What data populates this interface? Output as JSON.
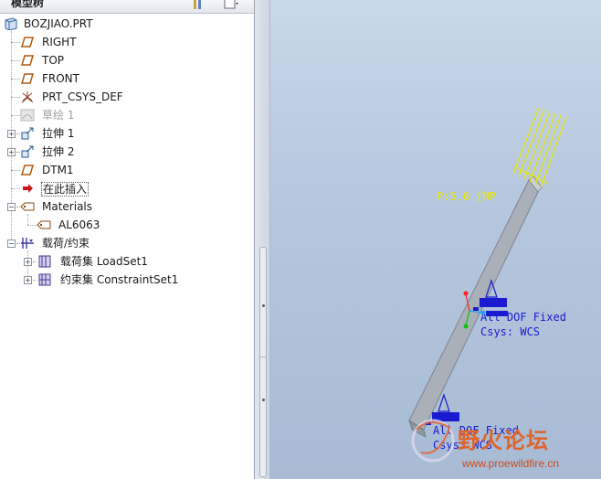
{
  "tree": {
    "header_title": "模型树",
    "items": [
      {
        "label": "BOZJIAO.PRT",
        "icon": "part-icon"
      },
      {
        "label": "RIGHT",
        "icon": "datum-plane-icon"
      },
      {
        "label": "TOP",
        "icon": "datum-plane-icon"
      },
      {
        "label": "FRONT",
        "icon": "datum-plane-icon"
      },
      {
        "label": "PRT_CSYS_DEF",
        "icon": "csys-icon"
      },
      {
        "label": "草绘 1",
        "icon": "sketch-icon"
      },
      {
        "label": "拉伸 1",
        "icon": "extrude-icon"
      },
      {
        "label": "拉伸 2",
        "icon": "extrude-icon"
      },
      {
        "label": "DTM1",
        "icon": "datum-plane-icon"
      },
      {
        "label": "在此插入",
        "icon": "insert-arrow-icon"
      },
      {
        "label": "Materials",
        "icon": "materials-icon"
      },
      {
        "label": "AL6063",
        "icon": "material-item-icon"
      },
      {
        "label": "载荷/约束",
        "icon": "loads-constraints-icon"
      },
      {
        "label": "载荷集 LoadSet1",
        "icon": "loadset-icon"
      },
      {
        "label": "约束集 ConstraintSet1",
        "icon": "constraintset-icon"
      }
    ]
  },
  "viewport": {
    "pressure_label": "P:5.6 [MP",
    "dof_label_1": "All DOF Fixed",
    "csys_label_1": "Csys: WCS",
    "dof_label_2": "All DOF Fixed",
    "csys_label_2": "Csys: WCS",
    "watermark_name": "野火论坛",
    "watermark_url": "www.proewildfire.cn",
    "colors": {
      "annotation_yellow": "#e8e800",
      "constraint_blue": "#1a1ad0",
      "beam_gray": "#a9b0b8"
    }
  }
}
